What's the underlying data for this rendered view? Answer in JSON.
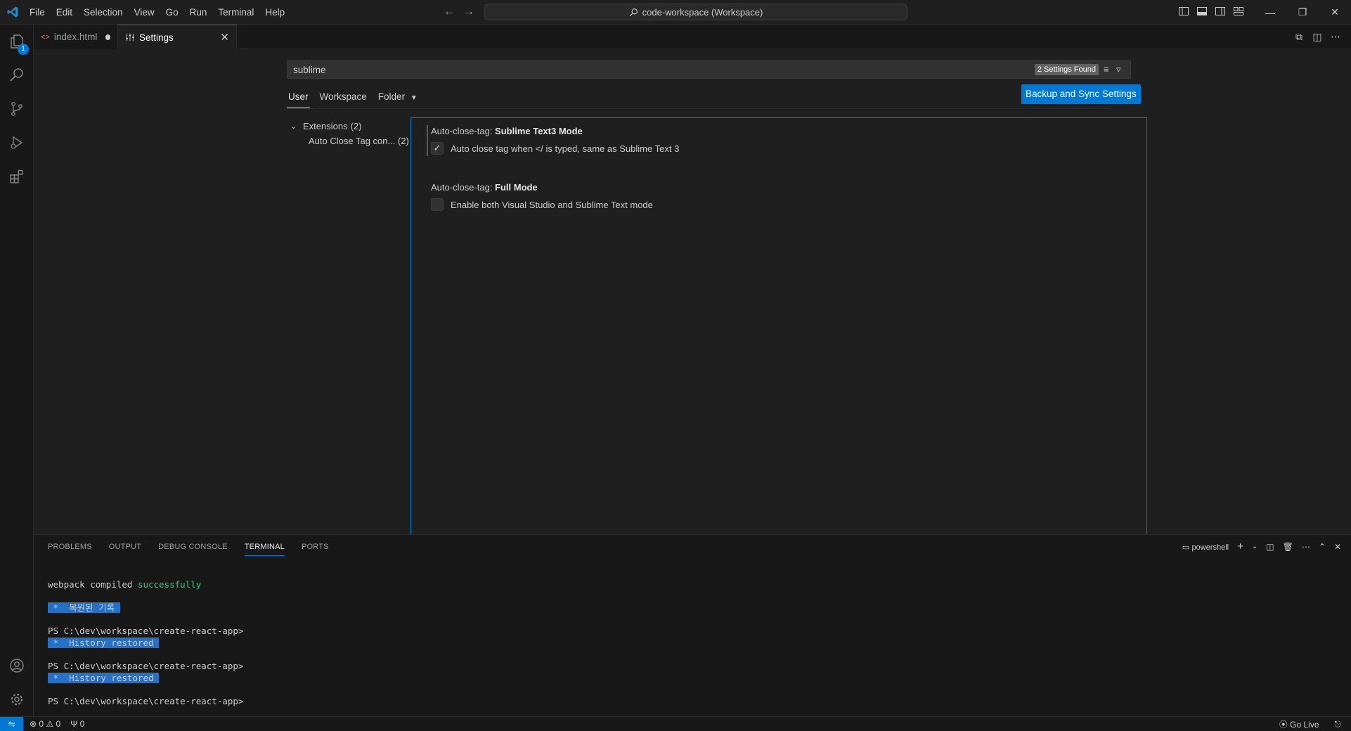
{
  "window": {
    "command_center_text": "code-workspace (Workspace)"
  },
  "menu": [
    "File",
    "Edit",
    "Selection",
    "View",
    "Go",
    "Run",
    "Terminal",
    "Help"
  ],
  "activity": {
    "explorer_badge": "1"
  },
  "tabs": [
    {
      "label": "index.html",
      "icon": "html-file-icon",
      "dirty": true
    },
    {
      "label": "Settings",
      "icon": "settings-editor-icon",
      "active": true
    }
  ],
  "settings": {
    "search_value": "sublime",
    "search_count": "2 Settings Found",
    "scopes": [
      "User",
      "Workspace",
      "Folder"
    ],
    "selected_scope": "User",
    "sync_button": "Backup and Sync Settings",
    "toc": {
      "group": "Extensions",
      "group_count": "(2)",
      "item": "Auto Close Tag con...",
      "item_count": "(2)"
    },
    "items": [
      {
        "prefix": "Auto-close-tag: ",
        "name": "Sublime Text3 Mode",
        "description": "Auto close tag when </ is typed, same as Sublime Text 3",
        "checked": true
      },
      {
        "prefix": "Auto-close-tag: ",
        "name": "Full Mode",
        "description": "Enable both Visual Studio and Sublime Text mode",
        "checked": false
      }
    ]
  },
  "panel": {
    "tabs": [
      "PROBLEMS",
      "OUTPUT",
      "DEBUG CONSOLE",
      "TERMINAL",
      "PORTS"
    ],
    "active_tab": "TERMINAL",
    "shell": "powershell",
    "terminal": {
      "line1_prefix": "webpack compiled ",
      "line1_success": "successfully",
      "restored_ko": " *  복원된 기록 ",
      "prompt": "PS C:\\dev\\workspace\\create-react-app>",
      "restored_en": " *  History restored "
    }
  },
  "status": {
    "errors": "0",
    "warnings": "0",
    "ports": "0",
    "go_live": "Go Live"
  },
  "colors": {
    "accent": "#0078d4",
    "terminal_highlight": "#2472c8",
    "terminal_success": "#23d18b"
  }
}
